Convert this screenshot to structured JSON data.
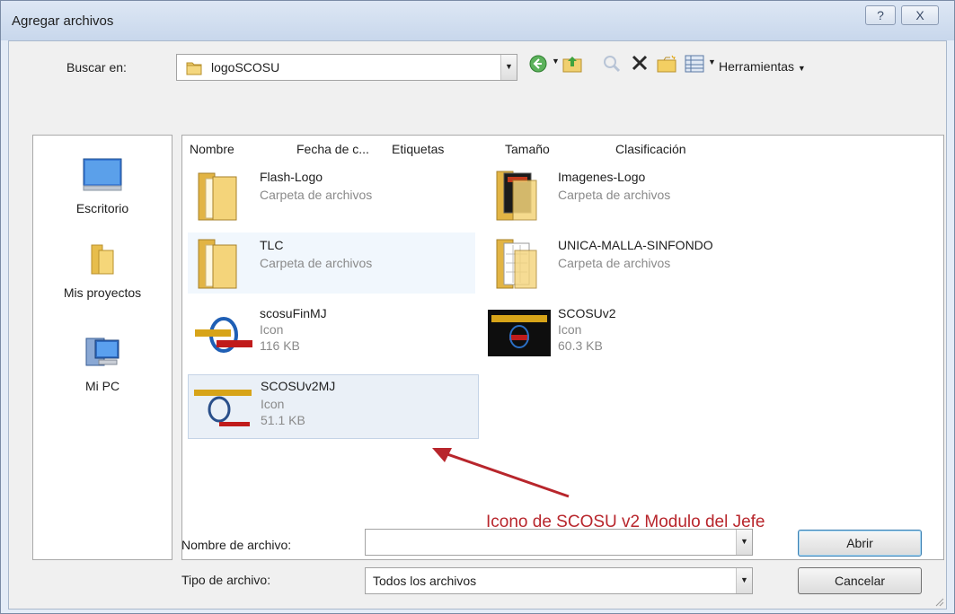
{
  "window": {
    "title": "Agregar archivos",
    "help_glyph": "?",
    "close_glyph": "X"
  },
  "lookin": {
    "label": "Buscar en:",
    "value": "logoSCOSU"
  },
  "toolbar": {
    "tools_label": "Herramientas"
  },
  "places": [
    {
      "label": "Escritorio",
      "icon": "desktop-icon"
    },
    {
      "label": "Mis proyectos",
      "icon": "folder-icon"
    },
    {
      "label": "Mi PC",
      "icon": "computer-icon"
    }
  ],
  "columns": [
    "Nombre",
    "Fecha de c...",
    "Etiquetas",
    "Tamaño",
    "Clasificación"
  ],
  "files": [
    {
      "name": "Flash-Logo",
      "type": "Carpeta de archivos",
      "size": ""
    },
    {
      "name": "Imagenes-Logo",
      "type": "Carpeta de archivos",
      "size": ""
    },
    {
      "name": "TLC",
      "type": "Carpeta de archivos",
      "size": ""
    },
    {
      "name": "UNICA-MALLA-SINFONDO",
      "type": "Carpeta de archivos",
      "size": ""
    },
    {
      "name": "scosuFinMJ",
      "type": "Icon",
      "size": "116 KB"
    },
    {
      "name": "SCOSUv2",
      "type": "Icon",
      "size": "60.3 KB"
    },
    {
      "name": "SCOSUv2MJ",
      "type": "Icon",
      "size": "51.1 KB"
    }
  ],
  "annotation": {
    "text": "Icono de SCOSU v2 Modulo del Jefe",
    "color": "#b8262c"
  },
  "filename": {
    "label": "Nombre de archivo:",
    "value": ""
  },
  "filetype": {
    "label": "Tipo de archivo:",
    "value": "Todos los archivos"
  },
  "buttons": {
    "open": "Abrir",
    "cancel": "Cancelar"
  }
}
